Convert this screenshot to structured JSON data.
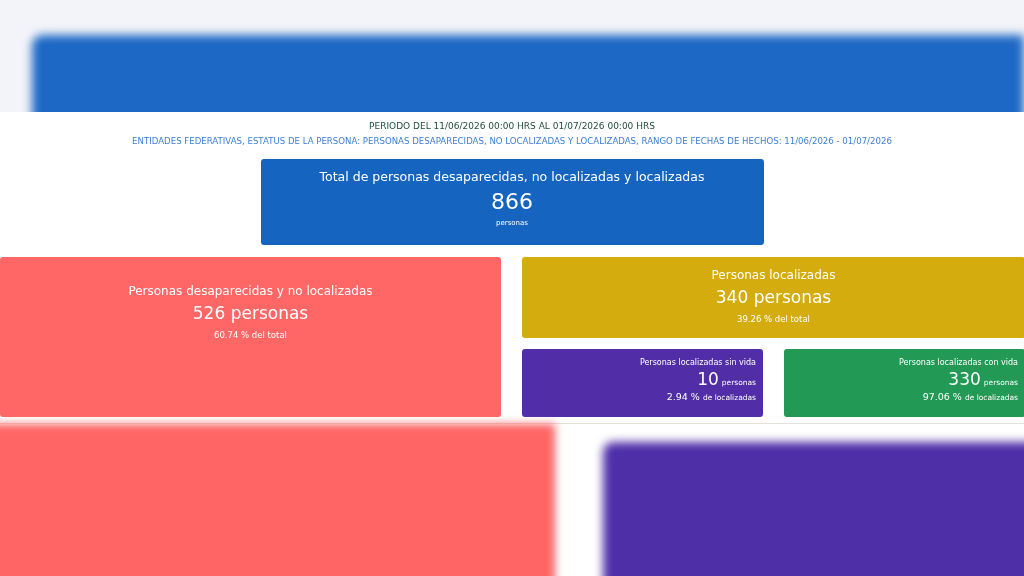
{
  "period": "PERIODO DEL 11/06/2026 00:00 HRS AL 01/07/2026 00:00 HRS",
  "filters": "ENTIDADES FEDERATIVAS, ESTATUS DE LA PERSONA: PERSONAS DESAPARECIDAS, NO LOCALIZADAS Y LOCALIZADAS, RANGO DE FECHAS DE HECHOS: 11/06/2026 - 01/07/2026",
  "total": {
    "title": "Total de personas desaparecidas, no localizadas y localizadas",
    "value": "866",
    "unit": "personas",
    "color": "#1565c0"
  },
  "cards": [
    {
      "kind": "main",
      "title": "Personas desaparecidas y no localizadas",
      "value": "526 personas",
      "share": "60.74 % del total",
      "color": "#ff6666"
    },
    {
      "kind": "main",
      "title": "Personas localizadas",
      "value": "340 personas",
      "share": "39.26 % del total",
      "color": "#d4ac0d"
    },
    {
      "kind": "sub",
      "title": "Personas localizadas sin vida",
      "value": "10",
      "unit": "personas",
      "share": "2.94 %",
      "share_label": "de localizadas",
      "color": "#512da8"
    },
    {
      "kind": "sub",
      "title": "Personas localizadas con vida",
      "value": "330",
      "unit": "personas",
      "share": "97.06 %",
      "share_label": "de localizadas",
      "color": "#229954"
    }
  ]
}
